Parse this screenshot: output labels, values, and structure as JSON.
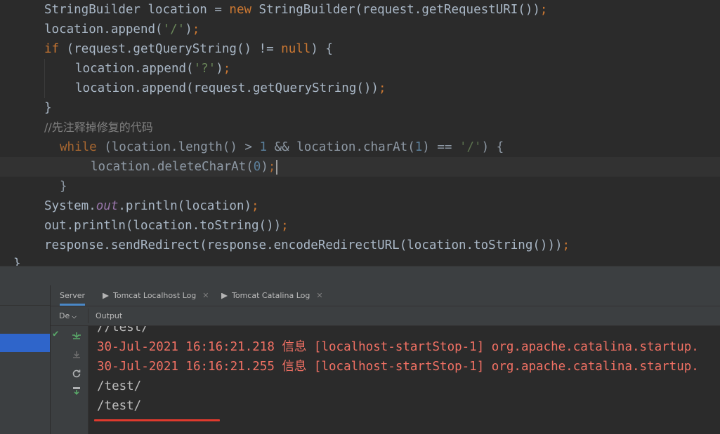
{
  "editor": {
    "lines": [
      {
        "tokens": [
          {
            "t": "StringBuilder location = "
          },
          {
            "t": "new",
            "c": "kw"
          },
          {
            "t": " StringBuilder(request.getRequestURI())"
          },
          {
            "t": ";",
            "c": "kw"
          }
        ]
      },
      {
        "tokens": [
          {
            "t": "location.append("
          },
          {
            "t": "'/'",
            "c": "str"
          },
          {
            "t": ")"
          },
          {
            "t": ";",
            "c": "kw"
          }
        ]
      },
      {
        "tokens": [
          {
            "t": "if",
            "c": "kw"
          },
          {
            "t": " (request.getQueryString() != "
          },
          {
            "t": "null",
            "c": "kw"
          },
          {
            "t": ") {"
          }
        ]
      },
      {
        "tokens": [
          {
            "t": "location.append("
          },
          {
            "t": "'?'",
            "c": "str"
          },
          {
            "t": ")"
          },
          {
            "t": ";",
            "c": "kw"
          }
        ]
      },
      {
        "tokens": [
          {
            "t": "location.append(request.getQueryString())"
          },
          {
            "t": ";",
            "c": "kw"
          }
        ]
      },
      {
        "tokens": [
          {
            "t": "}"
          }
        ]
      },
      {
        "tokens": [
          {
            "t": "//先注释掉修复的代码",
            "c": "cmt"
          }
        ]
      },
      {
        "tokens": [
          {
            "t": "while",
            "c": "kw"
          },
          {
            "t": " (location.length() > "
          },
          {
            "t": "1",
            "c": "num"
          },
          {
            "t": " && location.charAt("
          },
          {
            "t": "1",
            "c": "num"
          },
          {
            "t": ") == "
          },
          {
            "t": "'/'",
            "c": "str"
          },
          {
            "t": ") {"
          }
        ]
      },
      {
        "tokens": [
          {
            "t": "location.deleteCharAt("
          },
          {
            "t": "0",
            "c": "num"
          },
          {
            "t": ")"
          },
          {
            "t": ";",
            "c": "kw"
          }
        ]
      },
      {
        "tokens": [
          {
            "t": "}"
          }
        ]
      },
      {
        "tokens": [
          {
            "t": "System."
          },
          {
            "t": "out",
            "c": "fld"
          },
          {
            "t": ".println(location)"
          },
          {
            "t": ";",
            "c": "kw"
          }
        ]
      },
      {
        "tokens": [
          {
            "t": "out.println(location.toString())"
          },
          {
            "t": ";",
            "c": "kw"
          }
        ]
      },
      {
        "tokens": [
          {
            "t": "response.sendRedirect(response.encodeRedirectURL(location.toString()))"
          },
          {
            "t": ";",
            "c": "kw"
          }
        ]
      },
      {
        "tokens": [
          {
            "t": "}"
          }
        ]
      }
    ]
  },
  "tabs": [
    {
      "label": "Server",
      "active": true,
      "icon": ""
    },
    {
      "label": "Tomcat Localhost Log",
      "active": false,
      "icon": "log-icon"
    },
    {
      "label": "Tomcat Catalina Log",
      "active": false,
      "icon": "log-icon"
    }
  ],
  "subbar": {
    "deploy_label": "De",
    "output_label": "Output"
  },
  "gutter_icons": [
    "check-icon",
    "deploy-icon",
    "undeploy-icon",
    "refresh-icon",
    "update-icon"
  ],
  "console": {
    "lines": [
      {
        "text": "//test/",
        "style": "plain"
      },
      {
        "text": "30-Jul-2021 16:16:21.218 信息 [localhost-startStop-1] org.apache.catalina.startup.",
        "style": "red"
      },
      {
        "text": "30-Jul-2021 16:16:21.255 信息 [localhost-startStop-1] org.apache.catalina.startup.",
        "style": "red"
      },
      {
        "text": "/test/",
        "style": "plain"
      },
      {
        "text": "/test/",
        "style": "plain"
      }
    ]
  },
  "colors": {
    "keyword": "#cc7832",
    "string": "#6a8759",
    "number": "#6897bb",
    "field": "#9876aa",
    "error": "#f27164",
    "highlight": "#e03a2d"
  }
}
